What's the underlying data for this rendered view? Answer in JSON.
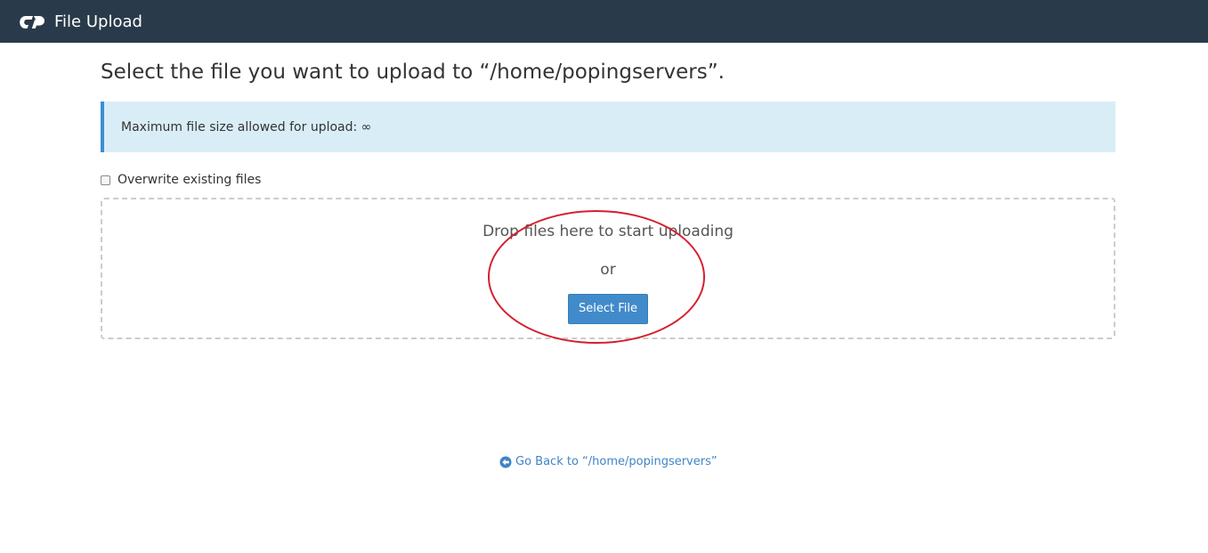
{
  "topbar": {
    "title": "File Upload",
    "logo_icon": "cpanel-logo-icon",
    "background": "#293a4a"
  },
  "main": {
    "heading": "Select the file you want to upload to “/home/popingservers”.",
    "info": {
      "text": "Maximum file size allowed for upload: ∞"
    },
    "overwrite": {
      "label": "Overwrite existing files",
      "checked": false
    },
    "dropzone": {
      "drop_text": "Drop files here to start uploading",
      "or_text": "or",
      "select_button": "Select File"
    },
    "annotation": {
      "shape": "ellipse",
      "color": "#d42030"
    },
    "back_link": {
      "text": "Go Back to “/home/popingservers”",
      "icon": "arrow-circle-left-icon"
    }
  },
  "colors": {
    "accent": "#428bca",
    "info_bg": "#d9edf7",
    "info_border": "#3b8fd0",
    "link": "#3f84c6"
  }
}
